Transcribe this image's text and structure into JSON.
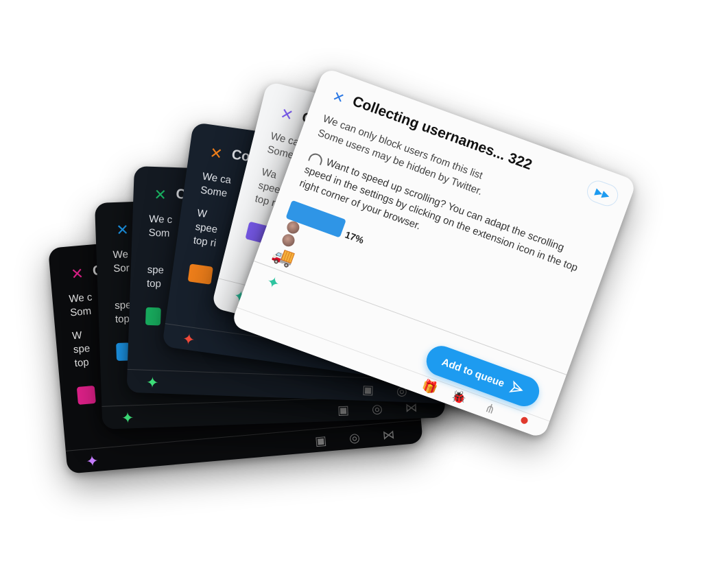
{
  "dialog": {
    "close_icon": "close-icon",
    "title": "Collecting usernames... 322",
    "info_line_1": "We can only block users from this list",
    "info_line_2": "Some users may be hidden by Twitter.",
    "tip": "Want to speed up scrolling? You can adapt the scrolling speed in the settings by clicking on the extension icon in the top right corner of your browser.",
    "progress": 0.17,
    "progress_label": "17%",
    "add_to_queue_label": "Add to queue",
    "fast_forward_icon": "fast-forward-icon",
    "sparkle_icon": "sparkle-icon",
    "footer_icons": [
      "gift-icon",
      "bug-icon",
      "share-icon",
      "bird-icon"
    ]
  },
  "background_cards": [
    {
      "theme": "black",
      "accent": "#e0218a",
      "x_color": "#e0218a",
      "spark": "#c77dff",
      "title": "C",
      "l1": "We c",
      "l2": "Som",
      "l3": "W",
      "l4": "spe",
      "l5": "top"
    },
    {
      "theme": "black",
      "accent": "#1d9bf0",
      "x_color": "#1d9bf0",
      "spark": "#3ee07a",
      "title": "C",
      "l1": "We",
      "l2": "Sor",
      "l3": "",
      "l4": "spe",
      "l5": "top"
    },
    {
      "theme": "dim",
      "accent": "#19b362",
      "x_color": "#19b362",
      "spark": "#3ee07a",
      "title": "C",
      "l1": "We c",
      "l2": "Som",
      "l3": "",
      "l4": "spe",
      "l5": "top"
    },
    {
      "theme": "navy",
      "accent": "#f07f1a",
      "x_color": "#f07f1a",
      "spark": "#f04a3a",
      "title": "Co",
      "l1": "We ca",
      "l2": "Some",
      "l3": "W",
      "l4": "spee",
      "l5": "top ri"
    },
    {
      "theme": "light",
      "accent": "#7b5cf0",
      "x_color": "#7b5cf0",
      "spark": "#2ec4a0",
      "title": "Co",
      "l1": "We ca",
      "l2": "Some",
      "l3": "Wa",
      "l4": "speed",
      "l5": "top rig"
    }
  ]
}
